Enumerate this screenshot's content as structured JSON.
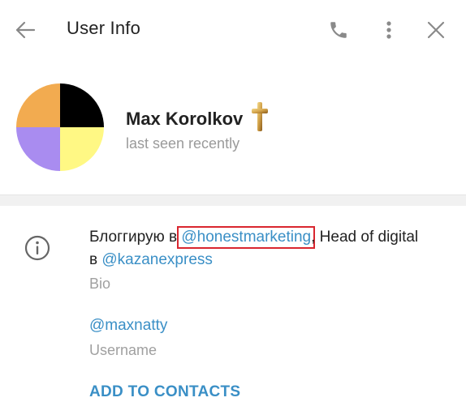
{
  "header": {
    "title": "User Info",
    "icons": {
      "back": "back-arrow-icon",
      "phone": "phone-icon",
      "more": "more-vertical-icon",
      "close": "close-icon"
    }
  },
  "profile": {
    "name": "Max Korolkov",
    "status": "last seen recently",
    "avatar_colors": [
      "#f2ab50",
      "#000000",
      "#a98cf0",
      "#fff884"
    ],
    "emoji": "cross-emoji"
  },
  "info": {
    "icon": "info-circle-icon",
    "bio_text_1": "Блоггирую в ",
    "bio_link_1": "@honestmarketing",
    "bio_text_2": ", Head of digital в ",
    "bio_link_2": "@kazanexpress",
    "bio_label": "Bio",
    "username": "@maxnatty",
    "username_label": "Username",
    "add_contact": "ADD TO CONTACTS"
  },
  "colors": {
    "link": "#3a8fc6",
    "highlight_border": "#d9262f",
    "secondary_text": "#9a9a9a"
  }
}
